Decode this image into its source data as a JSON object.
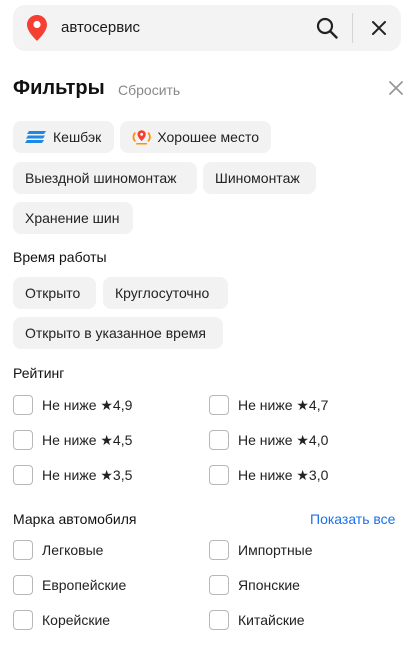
{
  "search": {
    "query": "автосервис"
  },
  "filters": {
    "title": "Фильтры",
    "reset_label": "Сбросить"
  },
  "feature_chips": {
    "cashback": "Кешбэк",
    "good_place": "Хорошее место",
    "mobile_tire": "Выездной шиномонтаж",
    "tire_service": "Шиномонтаж",
    "tire_storage": "Хранение шин"
  },
  "work_hours": {
    "title": "Время работы",
    "open_now": "Открыто",
    "round_clock": "Круглосуточно",
    "open_at_time": "Открыто в указанное время"
  },
  "rating": {
    "title": "Рейтинг",
    "options": [
      "Не ниже ★4,9",
      "Не ниже ★4,7",
      "Не ниже ★4,5",
      "Не ниже ★4,0",
      "Не ниже ★3,5",
      "Не ниже ★3,0"
    ]
  },
  "car_brand": {
    "title": "Марка автомобиля",
    "show_all": "Показать все",
    "options": [
      "Легковые",
      "Импортные",
      "Европейские",
      "Японские",
      "Корейские",
      "Китайские"
    ]
  },
  "colors": {
    "accent_link": "#1a73e8",
    "pin": "#f43f32",
    "cashback": "#1e88e5",
    "good_place": "#ff9100"
  },
  "icons": [
    "map-pin-icon",
    "search-icon",
    "close-icon",
    "cashback-icon",
    "good-place-icon"
  ]
}
